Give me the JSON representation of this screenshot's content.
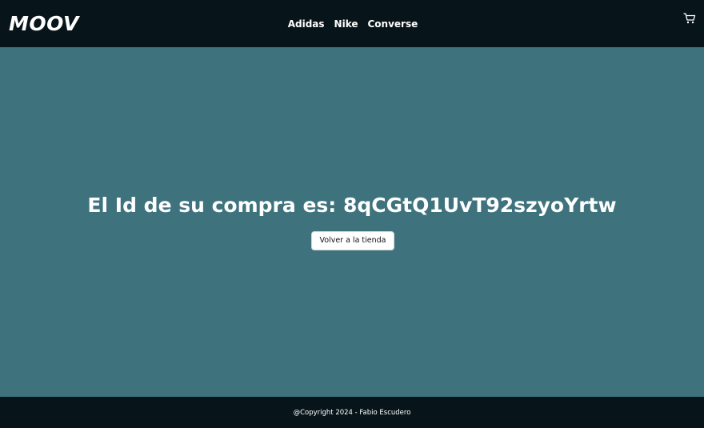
{
  "navbar": {
    "brand": "MOOV",
    "links": [
      "Adidas",
      "Nike",
      "Converse"
    ],
    "cart_icon": "cart-icon"
  },
  "main": {
    "order_message": "El Id de su compra es: 8qCGtQ1UvT92szyoYrtw",
    "back_button_label": "Volver a la tienda"
  },
  "footer": {
    "copyright": "@Copyright 2024 - Fabio Escudero"
  },
  "colors": {
    "header_bg": "#07151a",
    "content_bg": "#3e737e",
    "text": "#ffffff",
    "button_bg": "#ffffff"
  }
}
